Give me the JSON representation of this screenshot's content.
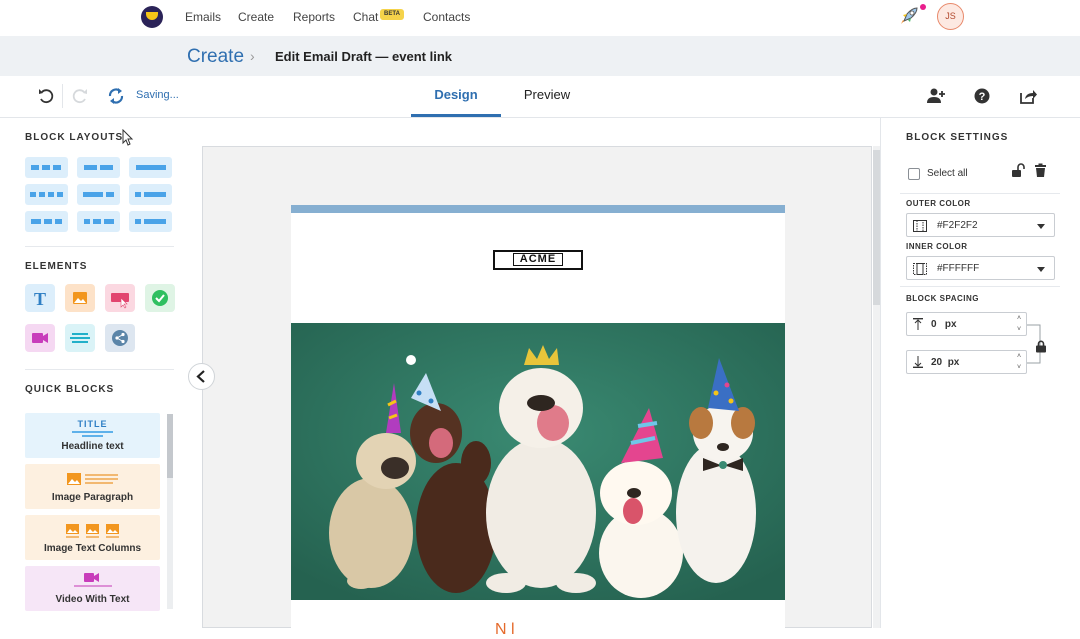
{
  "nav": {
    "items": [
      "Emails",
      "Create",
      "Reports",
      "Chat",
      "Contacts"
    ],
    "chat_badge": "BETA",
    "avatar_initials": "JS"
  },
  "breadcrumb": {
    "parent": "Create",
    "separator": "›",
    "title": "Edit Email Draft — event link"
  },
  "toolbar": {
    "status": "Saving...",
    "tabs": [
      "Design",
      "Preview"
    ],
    "active_tab": "Design"
  },
  "left_panel": {
    "block_layouts_heading": "BLOCK LAYOUTS",
    "elements_heading": "ELEMENTS",
    "quick_blocks_heading": "QUICK BLOCKS",
    "elements": [
      "text-icon",
      "image-icon",
      "button-icon",
      "social-follow-icon",
      "video-icon",
      "divider-icon",
      "share-icon"
    ],
    "quick_blocks": [
      {
        "tag": "TITLE",
        "label": "Headline text",
        "color": "#e5f3fc"
      },
      {
        "tag": "",
        "label": "Image Paragraph",
        "color": "#fdf0e0"
      },
      {
        "tag": "",
        "label": "Image Text Columns",
        "color": "#fdf0e0"
      },
      {
        "tag": "",
        "label": "Video With Text",
        "color": "#f6e6f7"
      }
    ]
  },
  "email": {
    "logo_text": "ACME",
    "heading_peek": "N    l  "
  },
  "right_panel": {
    "heading": "BLOCK SETTINGS",
    "select_all": "Select all",
    "outer_color_label": "OUTER COLOR",
    "outer_color": "#F2F2F2",
    "inner_color_label": "INNER COLOR",
    "inner_color": "#FFFFFF",
    "spacing_label": "BLOCK SPACING",
    "spacing_top": "0",
    "spacing_bottom": "20",
    "unit": "px"
  },
  "colors": {
    "accent": "#2f6fb0",
    "hero_bg": "#2e7560",
    "email_topbar": "#86afd1"
  }
}
